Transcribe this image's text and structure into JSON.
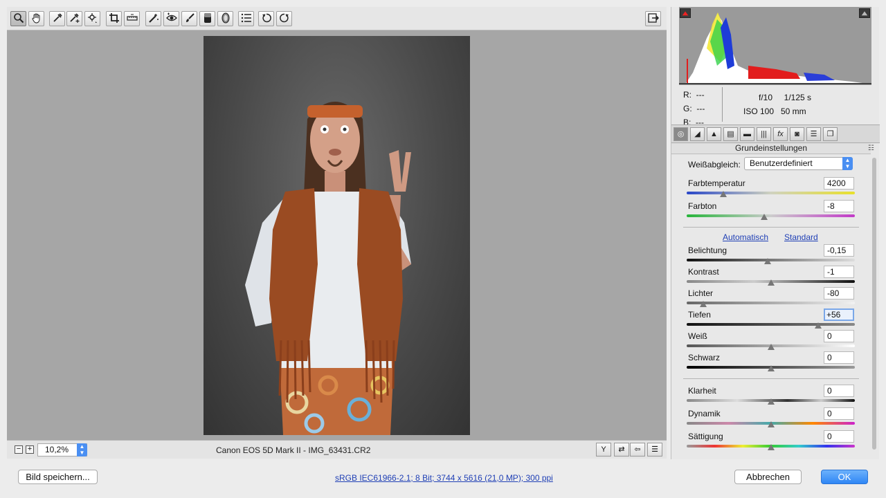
{
  "toolbar": {
    "tools": [
      "zoom-tool",
      "hand-tool",
      "white-balance-tool",
      "color-sampler-tool",
      "targeted-adjustment-tool",
      "crop-tool",
      "straighten-tool",
      "spot-removal-tool",
      "red-eye-tool",
      "adjustment-brush",
      "graduated-filter",
      "radial-filter",
      "preferences",
      "rotate-left",
      "rotate-right"
    ],
    "active_tool": "zoom-tool"
  },
  "preview": {
    "zoom_minus": "−",
    "zoom_plus": "+",
    "zoom_value": "10,2%",
    "file_info": "Canon EOS 5D Mark II - IMG_63431.CR2"
  },
  "histogram": {
    "r_label": "R:",
    "r_value": "---",
    "g_label": "G:",
    "g_value": "---",
    "b_label": "B:",
    "b_value": "---",
    "aperture": "f/10",
    "shutter": "1/125 s",
    "iso": "ISO 100",
    "focal": "50 mm"
  },
  "panel": {
    "title": "Grundeinstellungen",
    "wb_label": "Weißabgleich:",
    "wb_value": "Benutzerdefiniert",
    "auto_link": "Automatisch",
    "default_link": "Standard",
    "sliders": [
      {
        "label": "Farbtemperatur",
        "value": "4200",
        "pos": 0.22
      },
      {
        "label": "Farbton",
        "value": "-8",
        "pos": 0.46
      },
      {
        "label": "Belichtung",
        "value": "-0,15",
        "pos": 0.48
      },
      {
        "label": "Kontrast",
        "value": "-1",
        "pos": 0.5
      },
      {
        "label": "Lichter",
        "value": "-80",
        "pos": 0.1
      },
      {
        "label": "Tiefen",
        "value": "+56",
        "pos": 0.78
      },
      {
        "label": "Weiß",
        "value": "0",
        "pos": 0.5
      },
      {
        "label": "Schwarz",
        "value": "0",
        "pos": 0.5
      },
      {
        "label": "Klarheit",
        "value": "0",
        "pos": 0.5
      },
      {
        "label": "Dynamik",
        "value": "0",
        "pos": 0.5
      },
      {
        "label": "Sättigung",
        "value": "0",
        "pos": 0.5
      }
    ]
  },
  "footer": {
    "save_button": "Bild speichern...",
    "workflow_link": "sRGB IEC61966-2.1; 8 Bit; 3744 x 5616 (21,0 MP); 300 ppi",
    "cancel_button": "Abbrechen",
    "ok_button": "OK"
  },
  "colors": {
    "accent": "#2f86f5",
    "link": "#1f3fb5",
    "preview_bg": "#a6a6a6"
  }
}
